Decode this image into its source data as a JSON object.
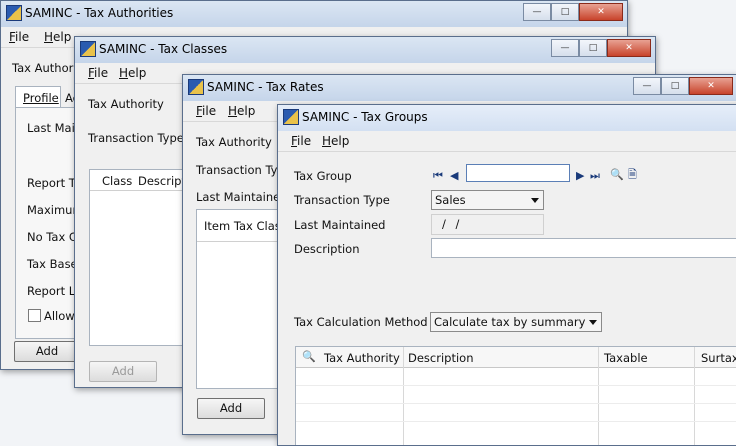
{
  "app_name": "SAMINC",
  "windows": {
    "tax_authorities": {
      "title": "SAMINC - Tax Authorities",
      "menu": [
        "File",
        "Help"
      ],
      "field_label": "Tax Authority",
      "tabs": [
        "Profile",
        "Ac"
      ],
      "rows": [
        "Last Maint",
        "Report Ta",
        "Maximum",
        "No Tax Ch",
        "Tax Base",
        "Report Le",
        "Allow T"
      ],
      "add_label": "Add"
    },
    "tax_classes": {
      "title": "SAMINC - Tax Classes",
      "menu": [
        "File",
        "Help"
      ],
      "tax_authority_label": "Tax Authority",
      "transaction_type_label": "Transaction Type",
      "columns": [
        "Class",
        "Descriptio"
      ],
      "add_label": "Add"
    },
    "tax_rates": {
      "title": "SAMINC - Tax Rates",
      "menu": [
        "File",
        "Help"
      ],
      "tax_authority_label": "Tax Authority",
      "transaction_type_label": "Transaction Type",
      "last_maintained_label": "Last Maintained",
      "grid_header": "Item Tax Class",
      "add_label": "Add"
    },
    "tax_groups": {
      "title": "SAMINC - Tax Groups",
      "menu": [
        "File",
        "Help"
      ],
      "tax_group_label": "Tax Group",
      "tax_group_value": "",
      "transaction_type_label": "Transaction Type",
      "transaction_type_value": "Sales",
      "last_maintained_label": "Last Maintained",
      "last_maintained_value": "/ /",
      "description_label": "Description",
      "description_value": "",
      "calc_method_label": "Tax Calculation Method",
      "calc_method_value": "Calculate tax by summary",
      "grid_columns": [
        "Tax Authority",
        "Description",
        "Taxable",
        "Surtax"
      ]
    }
  },
  "colors": {
    "titlebar": "#d3e0f2",
    "close_button": "#c8432b",
    "window_bg": "#f0f0f0"
  }
}
